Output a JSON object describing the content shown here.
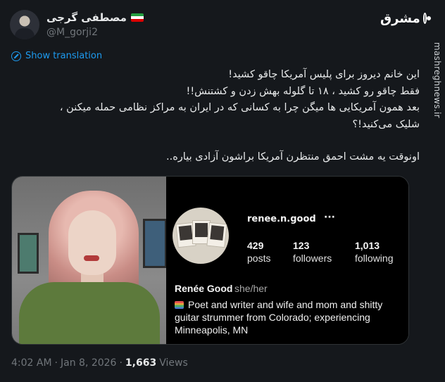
{
  "author": {
    "display_name": "مصطفی گرجی",
    "handle": "@M_gorji2",
    "flag_colors": [
      "#239f40",
      "#ffffff",
      "#da0000"
    ]
  },
  "brand": {
    "logo": "مشرق",
    "watermark": "mashreghnews.ir"
  },
  "translate_label": "Show translation",
  "tweet_lines": [
    "این خانم دیروز برای پلیس آمریکا چاقو کشید!",
    "فقط چاقو رو کشید ، ۱۸ تا گلوله بهش زدن و کشتنش!!",
    "بعد همون آمریکایی ها میگن چرا به کسانی که در ایران به مراکز نظامی حمله میکنن ،",
    "شلیک می‌کنید!؟",
    "",
    "اونوقت یه مشت احمق منتظرن آمریکا براشون آزادی بیاره.."
  ],
  "card": {
    "username": "renee.n.good",
    "more_icon": "···",
    "stats": {
      "posts": {
        "value": "429",
        "label": "posts"
      },
      "followers": {
        "value": "123",
        "label": "followers"
      },
      "following": {
        "value": "1,013",
        "label": "following"
      }
    },
    "full_name": "Renée Good",
    "pronouns": "she/her",
    "bio": "Poet and writer and wife and mom and shitty guitar strummer from Colorado; experiencing Minneapolis, MN"
  },
  "meta": {
    "time": "4:02 AM",
    "separator": "·",
    "date": "Jan 8, 2026",
    "separator2": "·",
    "views_count": "1,663",
    "views_label": "Views"
  },
  "colors": {
    "background": "#15181c",
    "link": "#1d9bf0",
    "muted": "#71767b"
  }
}
